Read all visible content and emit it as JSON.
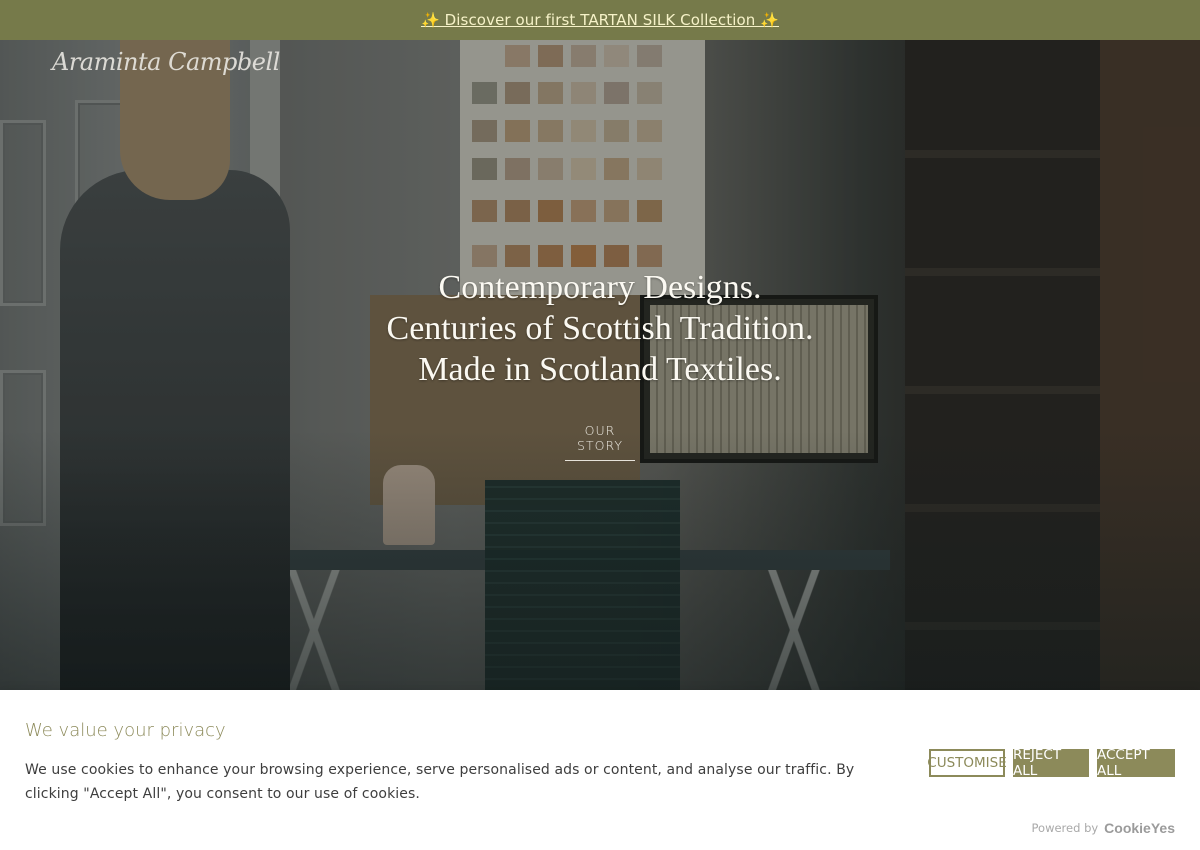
{
  "announcement": {
    "text": "✨ Discover our first TARTAN SILK Collection ✨"
  },
  "brand": {
    "logo_text": "Araminta Campbell"
  },
  "hero": {
    "line1": "Contemporary Designs.",
    "line2": "Centuries of Scottish Tradition.",
    "line3": "Made in Scotland Textiles.",
    "cta_label": "OUR STORY"
  },
  "cookie_banner": {
    "title": "We value your privacy",
    "description": "We use cookies to enhance your browsing experience, serve personalised ads or content, and analyse our traffic. By clicking \"Accept All\", you consent to our use of cookies.",
    "customise_label": "CUSTOMISE",
    "reject_label": "REJECT ALL",
    "accept_label": "ACCEPT ALL",
    "powered_by_label": "Powered by",
    "powered_by_brand": "CookieYes"
  },
  "colors": {
    "announcement_bg": "#767a4a",
    "accent": "#8c8a5a"
  }
}
